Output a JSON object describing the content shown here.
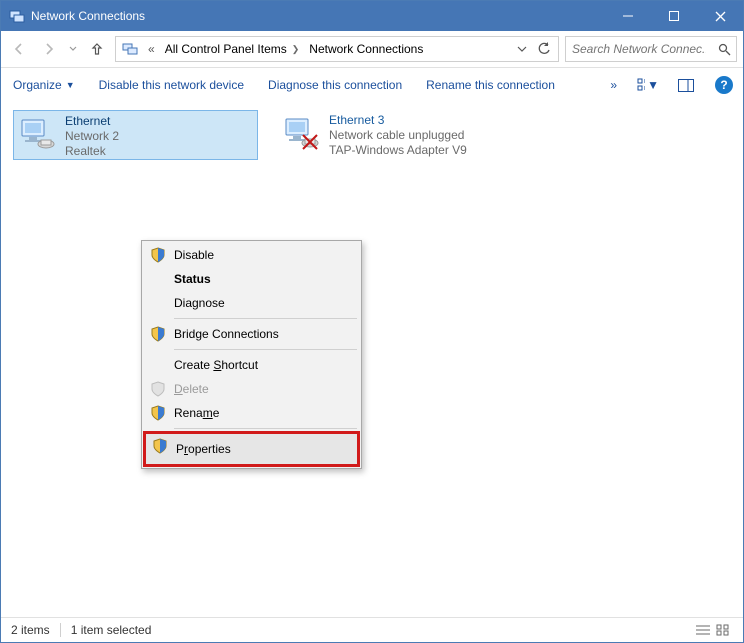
{
  "titlebar": {
    "title": "Network Connections"
  },
  "breadcrumb": {
    "prefix": "«",
    "seg1": "All Control Panel Items",
    "seg2": "Network Connections"
  },
  "search": {
    "placeholder": "Search Network Connec..."
  },
  "commands": {
    "organize": "Organize",
    "disable": "Disable this network device",
    "diagnose": "Diagnose this connection",
    "rename": "Rename this connection",
    "overflow": "»"
  },
  "items": [
    {
      "name": "Ethernet",
      "line2": "Network  2",
      "line3": "Realtek"
    },
    {
      "name": "Ethernet 3",
      "line2": "Network cable unplugged",
      "line3": "TAP-Windows Adapter V9"
    }
  ],
  "context_menu": {
    "disable": "Disable",
    "status": "Status",
    "diagnose": "Diagnose",
    "bridge": "Bridge Connections",
    "shortcut": "Create Shortcut",
    "delete": "Delete",
    "rename": "Rename",
    "properties": "Properties"
  },
  "statusbar": {
    "count": "2 items",
    "selection": "1 item selected"
  }
}
